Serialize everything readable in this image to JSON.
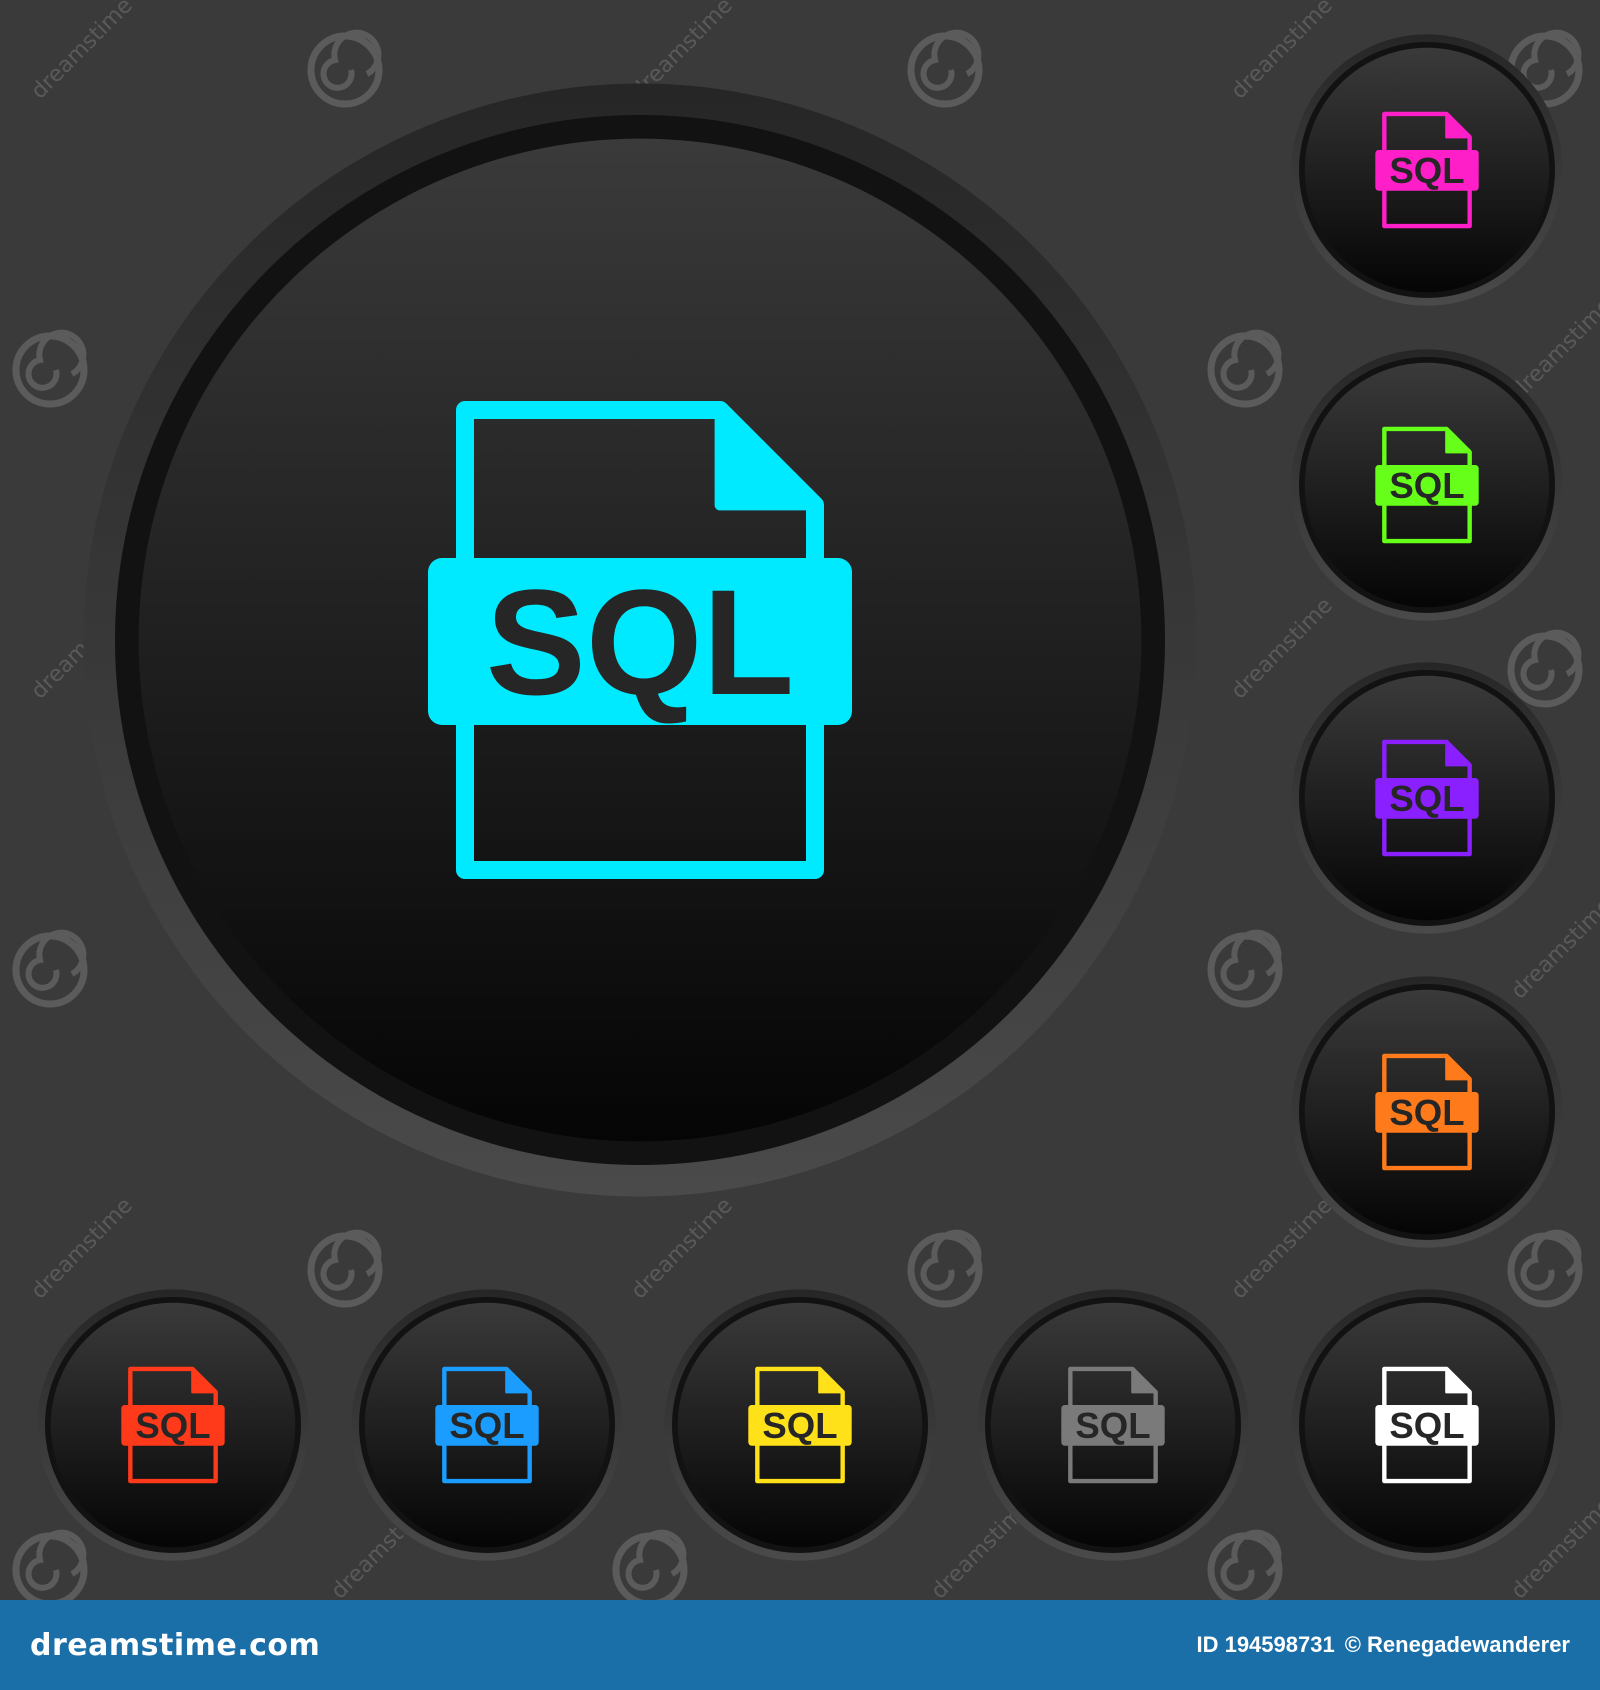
{
  "icon_label": "SQL",
  "main_button": {
    "color": "#00eaff"
  },
  "side_buttons": [
    {
      "color": "#ff1fc8"
    },
    {
      "color": "#66ff1a"
    },
    {
      "color": "#8a1fff"
    },
    {
      "color": "#ff7a1a"
    }
  ],
  "bottom_buttons": [
    {
      "color": "#ff3a1a"
    },
    {
      "color": "#1a9dff"
    },
    {
      "color": "#ffe11a"
    },
    {
      "color": "#7a7a7a"
    },
    {
      "color": "#ffffff"
    }
  ],
  "watermark": {
    "text": "dreamstime"
  },
  "footer": {
    "brand": "dreamstime.com",
    "id_label": "ID 194598731",
    "author": "© Renegadewanderer"
  }
}
